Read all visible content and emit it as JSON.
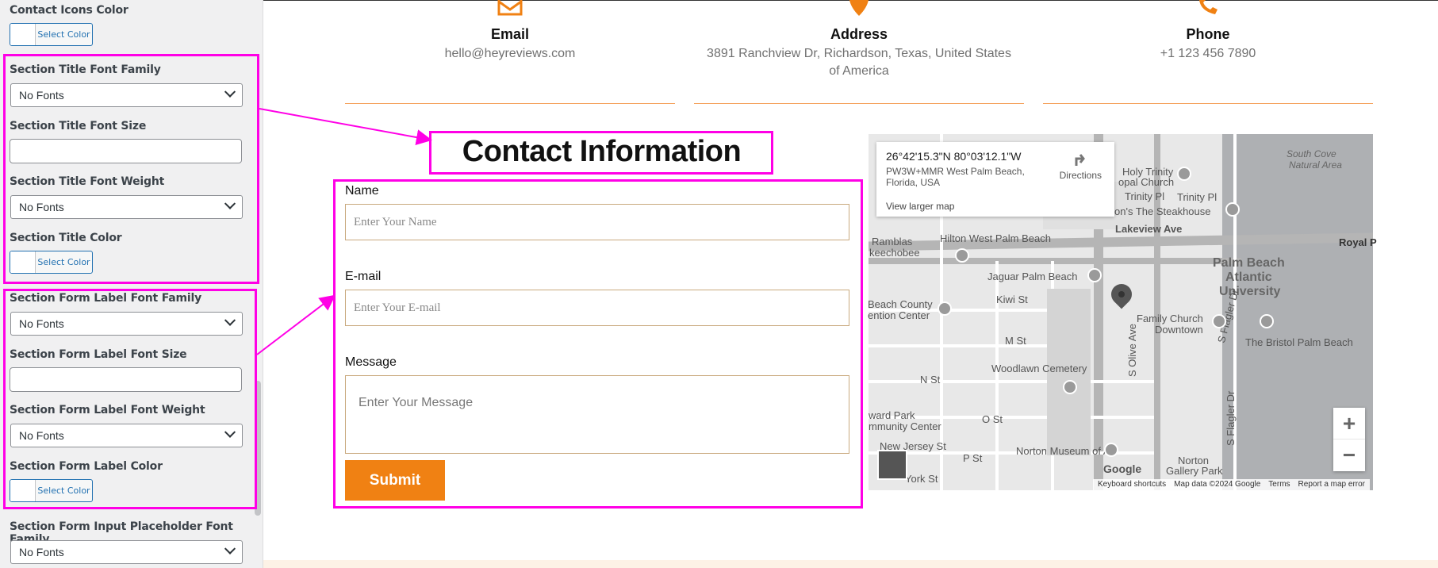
{
  "sidebar": {
    "fields": [
      {
        "label": "Contact Icons Color",
        "type": "color",
        "button": "Select Color"
      },
      {
        "label": "Section Title Font Family",
        "type": "select",
        "value": "No Fonts"
      },
      {
        "label": "Section Title Font Size",
        "type": "input",
        "value": ""
      },
      {
        "label": "Section Title Font Weight",
        "type": "select",
        "value": "No Fonts"
      },
      {
        "label": "Section Title Color",
        "type": "color",
        "button": "Select Color"
      },
      {
        "label": "Section Form Label Font Family",
        "type": "select",
        "value": "No Fonts"
      },
      {
        "label": "Section Form Label Font Size",
        "type": "input",
        "value": ""
      },
      {
        "label": "Section Form Label Font Weight",
        "type": "select",
        "value": "No Fonts"
      },
      {
        "label": "Section Form Label Color",
        "type": "color",
        "button": "Select Color"
      },
      {
        "label": "Section Form Input Placeholder Font Family",
        "type": "select",
        "value": "No Fonts"
      }
    ]
  },
  "contact_info": [
    {
      "title": "Email",
      "text": "hello@heyreviews.com",
      "icon": "envelope-icon"
    },
    {
      "title": "Address",
      "text": "3891 Ranchview Dr, Richardson, Texas, United States of America",
      "icon": "map-marker-icon"
    },
    {
      "title": "Phone",
      "text": "+1 123 456 7890",
      "icon": "phone-icon"
    }
  ],
  "section_title": "Contact Information",
  "form": {
    "name_label": "Name",
    "name_placeholder": "Enter Your Name",
    "email_label": "E-mail",
    "email_placeholder": "Enter Your E-mail",
    "message_label": "Message",
    "message_placeholder": "Enter Your Message",
    "submit": "Submit"
  },
  "map": {
    "coords": "26°42'15.3\"N 80°03'12.1\"W",
    "address": "PW3W+MMR West Palm Beach, Florida, USA",
    "directions": "Directions",
    "view_larger": "View larger map",
    "labels": {
      "holy_trinity": "Holy Trinity",
      "episcopal_church": "opal Church",
      "trinity_pl": "Trinity Pl",
      "trinity_pl2": "Trinity Pl",
      "steakhouse": "on's The Steakhouse",
      "lakeview": "Lakeview Ave",
      "royal": "Royal P",
      "south_cove": "South Cove",
      "natural_area": "Natural Area",
      "ramblas": "Ramblas",
      "keechobee": "keechobee",
      "hilton": "Hilton West Palm Beach",
      "jaguar": "Jaguar Palm Beach",
      "palm_beach": "Palm Beach",
      "atlantic": "Atlantic",
      "university": "University",
      "kiwi": "Kiwi St",
      "beach_county": "Beach County",
      "ention_center": "ention Center",
      "family_church": "Family Church",
      "downtown": "Downtown",
      "bristol": "The Bristol Palm Beach",
      "m_st": "M St",
      "n_st": "N St",
      "woodlawn": "Woodlawn Cemetery",
      "o_st": "O St",
      "ward_park": "ward Park",
      "mmunity_center": "mmunity Center",
      "new_jersey": "New Jersey St",
      "p_st": "P St",
      "norton_museum": "Norton Museum of Art",
      "york_st": "York St",
      "norton": "Norton",
      "gallery_park": "Gallery Park",
      "s_olive": "S Olive Ave",
      "s_flagler": "S Flagler Dr",
      "s_flagler2": "S Flagler Dr",
      "google": "Google"
    },
    "zoom_in": "+",
    "zoom_out": "−",
    "footer": {
      "shortcuts": "Keyboard shortcuts",
      "data": "Map data ©2024 Google",
      "terms": "Terms",
      "report": "Report a map error"
    }
  },
  "colors": {
    "accent": "#f08113",
    "highlight": "#ff00e6",
    "divider": "#f5a25d"
  }
}
